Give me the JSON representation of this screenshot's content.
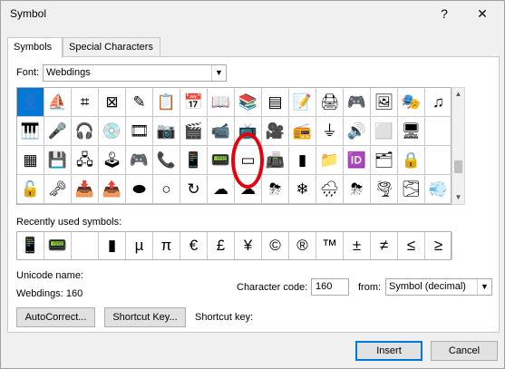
{
  "window": {
    "title": "Symbol",
    "help": "?",
    "close": "✕"
  },
  "tabs": [
    {
      "label": "Symbols",
      "hot": "S",
      "rest": "ymbols"
    },
    {
      "label": "Special Characters",
      "hot": "P",
      "pre": "S",
      "rest": "ecial Characters"
    }
  ],
  "font": {
    "label": "Font:",
    "value": "Webdings"
  },
  "symbols": [
    "👤",
    "⛵",
    "⌗",
    "⊠",
    "✎",
    "📋",
    "📅",
    "📖",
    "📚",
    "▤",
    "📝",
    "🖨",
    "🎮",
    "🖼",
    "🎭",
    "♫",
    "🎹",
    "🎤",
    "🎧",
    "💿",
    "🎞",
    "📷",
    "🎬",
    "📹",
    "📺",
    "🎥",
    "📻",
    "⏚",
    "🔊",
    "⬜",
    "🖥",
    "",
    "▦",
    "💾",
    "🖧",
    "🕹",
    "🎮",
    "📞",
    "📱",
    "📟",
    "▭",
    "📠",
    "▮",
    "📁",
    "🆔",
    "🗂",
    "🔒",
    "",
    "🔓",
    "🗝",
    "📥",
    "📤",
    "⬬",
    "○",
    "↻",
    "☁",
    "☁",
    "⛈",
    "❄",
    "🌧",
    "⛈",
    "🌪",
    "🌫",
    "💨"
  ],
  "recent_label": "Recently used symbols:",
  "recent": [
    "📱",
    "📟",
    "",
    "▮",
    "µ",
    "π",
    "€",
    "£",
    "¥",
    "©",
    "®",
    "™",
    "±",
    "≠",
    "≤",
    "≥"
  ],
  "unicode_name_label": "Unicode name:",
  "unicode_name_value": "Webdings: 160",
  "char_code_label": "Character code:",
  "char_code_value": "160",
  "from_label": "from:",
  "from_value": "Symbol (decimal)",
  "autocorrect_label": "AutoCorrect...",
  "shortcut_key_btn_label": "Shortcut Key...",
  "shortcut_key_label": "Shortcut key:",
  "insert_label": "Insert",
  "cancel_label": "Cancel"
}
